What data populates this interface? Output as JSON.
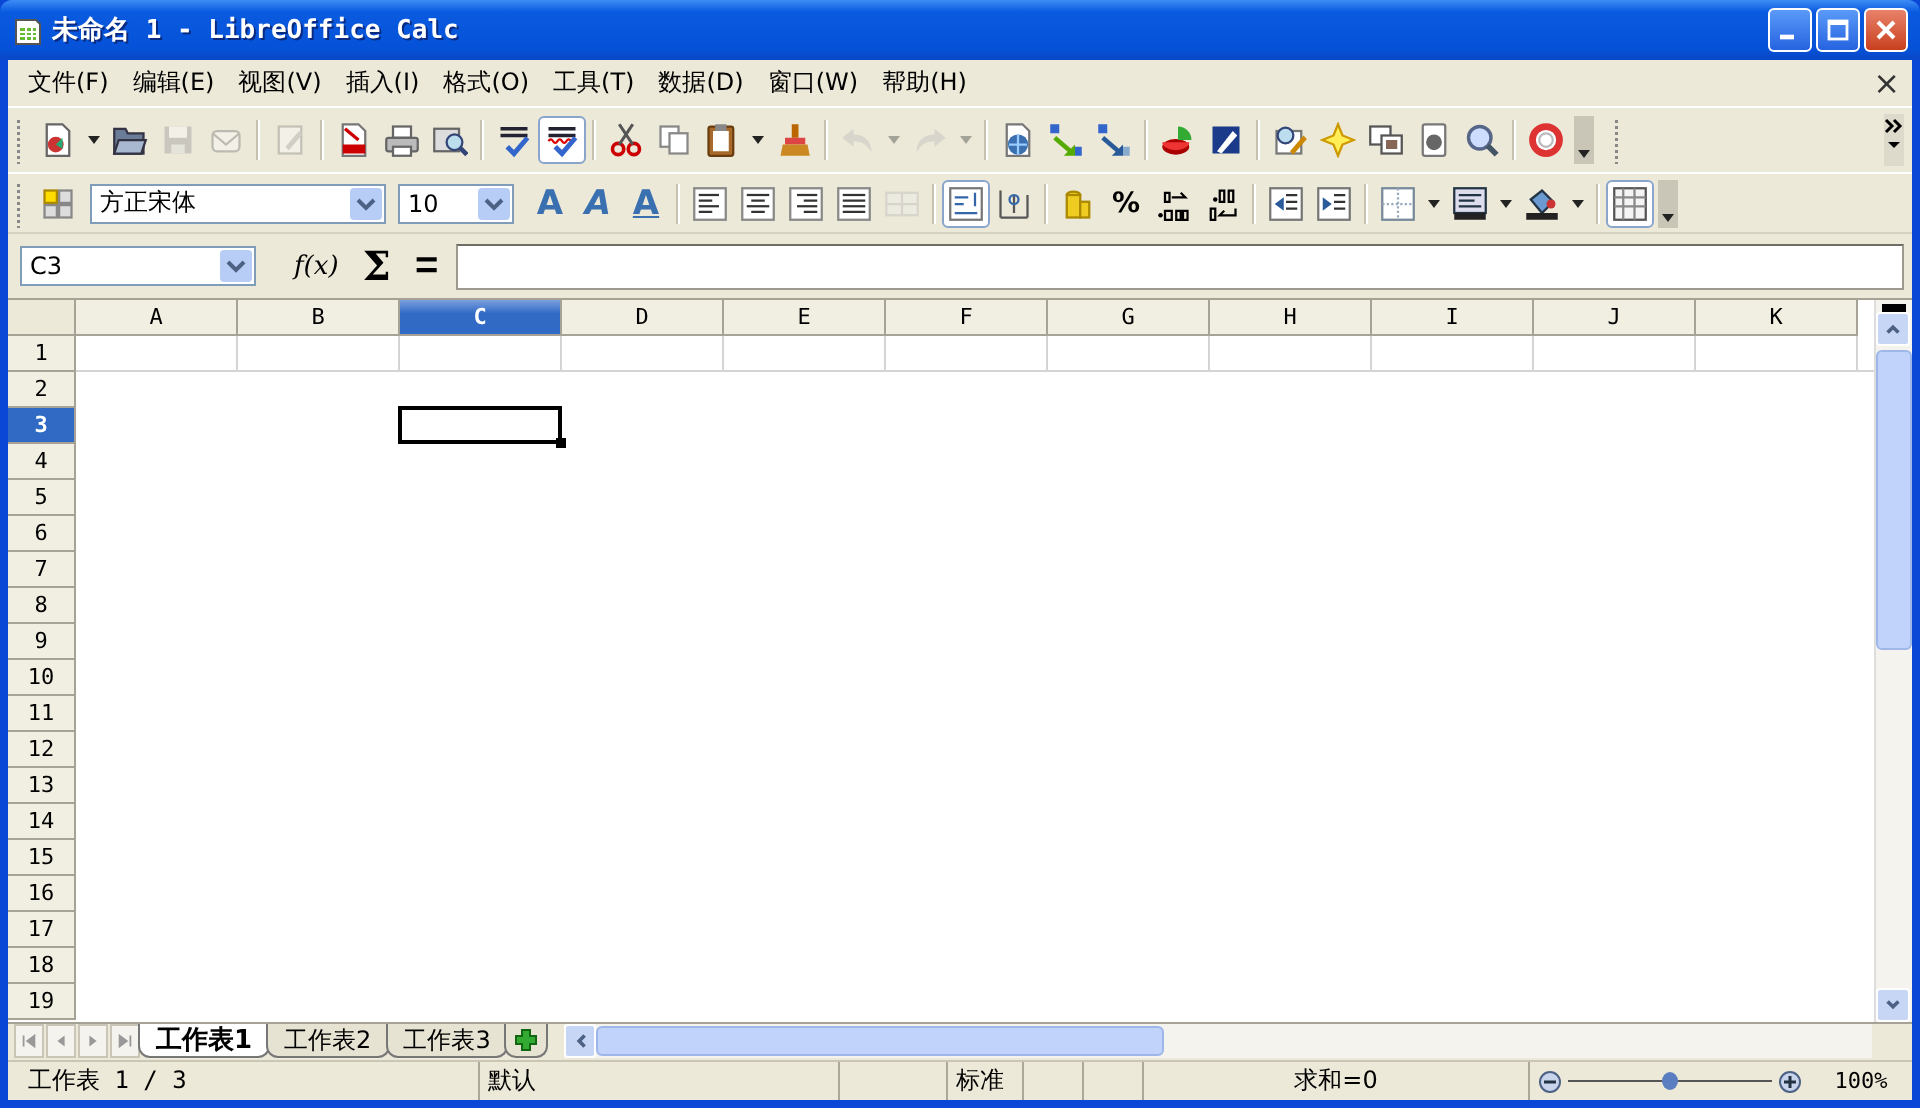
{
  "window": {
    "title": "未命名 1 - LibreOffice Calc"
  },
  "menu": {
    "items": [
      "文件(F)",
      "编辑(E)",
      "视图(V)",
      "插入(I)",
      "格式(O)",
      "工具(T)",
      "数据(D)",
      "窗口(W)",
      "帮助(H)"
    ],
    "close": "×"
  },
  "standard_toolbar": {
    "groups": [
      [
        {
          "kind": "new",
          "disabled": false,
          "on": false
        },
        {
          "kind": "open",
          "disabled": false,
          "on": false
        },
        {
          "kind": "save",
          "disabled": true,
          "on": false
        },
        {
          "kind": "mail",
          "disabled": true,
          "on": false
        }
      ],
      [
        {
          "kind": "edit",
          "disabled": true,
          "on": false
        }
      ],
      [
        {
          "kind": "pdf",
          "disabled": false,
          "on": false
        },
        {
          "kind": "print",
          "disabled": false,
          "on": false
        },
        {
          "kind": "preview",
          "disabled": false,
          "on": false
        }
      ],
      [
        {
          "kind": "spell",
          "disabled": false,
          "on": false
        },
        {
          "kind": "autospell",
          "disabled": false,
          "on": true
        }
      ],
      [
        {
          "kind": "cut",
          "disabled": false,
          "on": false
        },
        {
          "kind": "copy",
          "disabled": false,
          "on": false
        },
        {
          "kind": "paste",
          "disabled": false,
          "on": false
        },
        {
          "kind": "brush",
          "disabled": false,
          "on": false
        }
      ],
      [
        {
          "kind": "undo",
          "disabled": true,
          "on": false
        },
        {
          "kind": "redo",
          "disabled": true,
          "on": false
        }
      ],
      [
        {
          "kind": "link",
          "disabled": false,
          "on": false
        },
        {
          "kind": "sort-asc",
          "disabled": false,
          "on": false
        },
        {
          "kind": "sort-desc",
          "disabled": false,
          "on": false
        }
      ],
      [
        {
          "kind": "chart",
          "disabled": false,
          "on": false
        },
        {
          "kind": "draw",
          "disabled": false,
          "on": false
        }
      ],
      [
        {
          "kind": "navigator",
          "disabled": false,
          "on": false
        },
        {
          "kind": "gallery",
          "disabled": false,
          "on": false
        },
        {
          "kind": "data-sources",
          "disabled": false,
          "on": false
        },
        {
          "kind": "record",
          "disabled": false,
          "on": false
        },
        {
          "kind": "zoom",
          "disabled": false,
          "on": false
        }
      ],
      [
        {
          "kind": "help",
          "disabled": false,
          "on": false
        }
      ]
    ]
  },
  "formatting_toolbar": {
    "groups": [
      [
        {
          "kind": "styles",
          "disabled": false,
          "on": false
        }
      ],
      [
        {
          "kind": "font-name",
          "value": "方正宋体",
          "disabled": false,
          "on": false
        },
        {
          "kind": "font-size",
          "value": "10",
          "disabled": false,
          "on": false
        }
      ],
      [
        {
          "kind": "bold",
          "label": "A",
          "disabled": false,
          "on": false
        },
        {
          "kind": "italic",
          "label": "A",
          "disabled": false,
          "on": false
        },
        {
          "kind": "underline",
          "label": "A",
          "disabled": false,
          "on": false
        }
      ],
      [
        {
          "kind": "align-left",
          "disabled": false,
          "on": false
        },
        {
          "kind": "align-center",
          "disabled": false,
          "on": false
        },
        {
          "kind": "align-right",
          "disabled": false,
          "on": false
        },
        {
          "kind": "justify",
          "disabled": false,
          "on": false
        },
        {
          "kind": "merge",
          "disabled": true,
          "on": false
        }
      ],
      [
        {
          "kind": "wrap",
          "disabled": false,
          "on": true
        },
        {
          "kind": "wrap-vertical",
          "disabled": false,
          "on": false
        }
      ],
      [
        {
          "kind": "currency",
          "disabled": false,
          "on": false
        },
        {
          "kind": "percent",
          "label": "%",
          "disabled": false,
          "on": false
        },
        {
          "kind": "add-decimal",
          "disabled": false,
          "on": false
        },
        {
          "kind": "delete-decimal",
          "disabled": false,
          "on": false
        }
      ],
      [
        {
          "kind": "indent-decrease",
          "disabled": false,
          "on": false
        },
        {
          "kind": "indent-increase",
          "disabled": false,
          "on": false
        }
      ],
      [
        {
          "kind": "borders",
          "disabled": false,
          "on": false
        },
        {
          "kind": "lines",
          "disabled": false,
          "on": false
        },
        {
          "kind": "bucket",
          "disabled": false,
          "on": false
        }
      ],
      [
        {
          "kind": "gridlines",
          "disabled": false,
          "on": true
        }
      ]
    ]
  },
  "formula_bar": {
    "name_box": "C3",
    "function_wizard": "f(x)",
    "sum": "Σ",
    "equals": "="
  },
  "columns": [
    {
      "label": "A",
      "selected": false
    },
    {
      "label": "B",
      "selected": false
    },
    {
      "label": "C",
      "selected": true
    },
    {
      "label": "D",
      "selected": false
    },
    {
      "label": "E",
      "selected": false
    },
    {
      "label": "F",
      "selected": false
    },
    {
      "label": "G",
      "selected": false
    },
    {
      "label": "H",
      "selected": false
    },
    {
      "label": "I",
      "selected": false
    },
    {
      "label": "J",
      "selected": false
    },
    {
      "label": "K",
      "selected": false
    }
  ],
  "rows": [
    {
      "label": "1",
      "selected": false
    },
    {
      "label": "2",
      "selected": false
    },
    {
      "label": "3",
      "selected": true
    },
    {
      "label": "4",
      "selected": false
    },
    {
      "label": "5",
      "selected": false
    },
    {
      "label": "6",
      "selected": false
    },
    {
      "label": "7",
      "selected": false
    },
    {
      "label": "8",
      "selected": false
    },
    {
      "label": "9",
      "selected": false
    },
    {
      "label": "10",
      "selected": false
    },
    {
      "label": "11",
      "selected": false
    },
    {
      "label": "12",
      "selected": false
    },
    {
      "label": "13",
      "selected": false
    },
    {
      "label": "14",
      "selected": false
    },
    {
      "label": "15",
      "selected": false
    },
    {
      "label": "16",
      "selected": false
    },
    {
      "label": "17",
      "selected": false
    },
    {
      "label": "18",
      "selected": false
    },
    {
      "label": "19",
      "selected": false
    }
  ],
  "sheet_tabs": [
    {
      "label": "工作表1",
      "selected": true
    },
    {
      "label": "工作表2",
      "selected": false
    },
    {
      "label": "工作表3",
      "selected": false
    }
  ],
  "status_bar": {
    "sheet": "工作表 1 / 3",
    "page_style": "默认",
    "mode": "标准",
    "sum": "求和=0",
    "zoom": {
      "level": 0.5,
      "reading": "100%"
    }
  }
}
